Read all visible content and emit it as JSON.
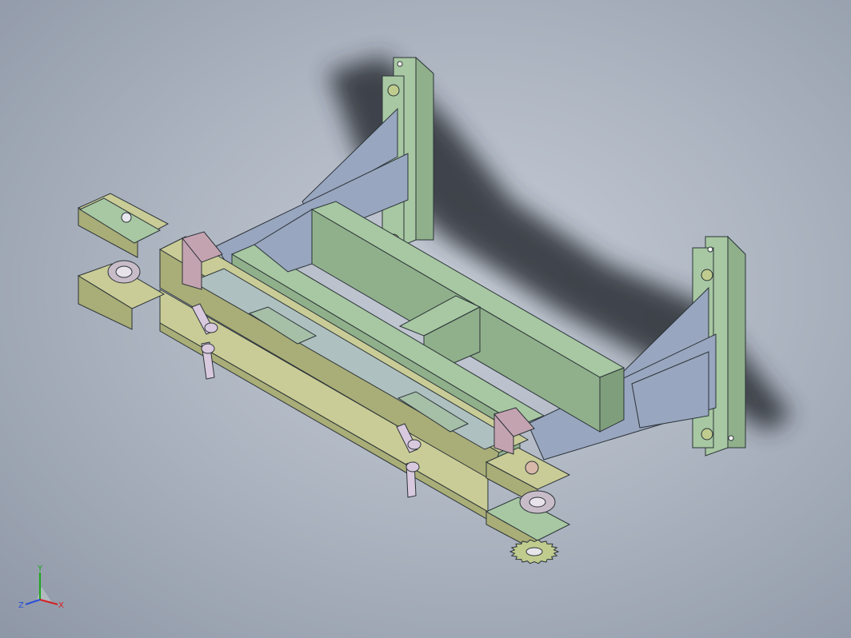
{
  "viewport": {
    "background_top": "#c6ccd6",
    "background_bottom": "#8e97a6"
  },
  "model": {
    "colors": {
      "frame_green": "#a7c8a2",
      "frame_green_dark": "#8fb08b",
      "frame_green_shadow": "#7f9f7c",
      "arm_olive": "#c9cc96",
      "arm_olive_dark": "#a9ad77",
      "rail_gray": "#aec0bf",
      "blue_gray": "#98a6bf",
      "pink_block": "#c4a3b0",
      "handle": "#d8c9de",
      "sprocket": "#bfcc8e",
      "edge": "#2c3338",
      "shadow": "#2b2f35"
    }
  },
  "triad": {
    "labels": {
      "x": "X",
      "y": "Y",
      "z": "Z"
    },
    "colors": {
      "x": "#d62020",
      "y": "#18a818",
      "z": "#2c4fd8"
    }
  }
}
